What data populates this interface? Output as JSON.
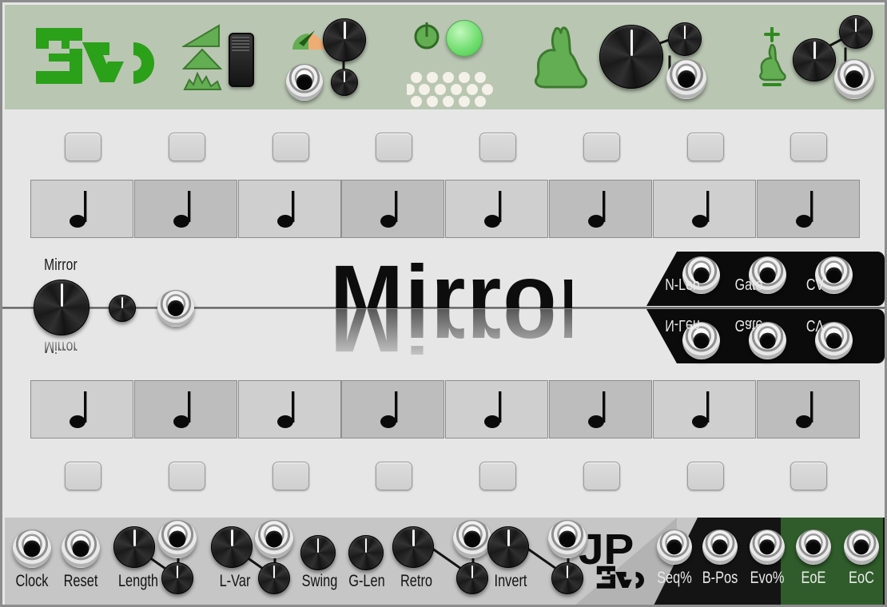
{
  "module": {
    "name": "Mirror",
    "brand": "Evo",
    "maker": "JP",
    "wordmark_top": "Mirror",
    "wordmark_bottom": "Mirror"
  },
  "header": {
    "brand_logo": "evo-logo",
    "controls": [
      {
        "name": "shape-selector",
        "icons": [
          "ramp-shape-icon",
          "triangle-shape-icon",
          "random-shape-icon"
        ],
        "widget": "shape-slider"
      },
      {
        "name": "rate",
        "icon": "gauge-icon",
        "knob": "rate-knob",
        "attenuator": "rate-attenuator-knob",
        "jack": "rate-cv-jack"
      },
      {
        "name": "run",
        "icon": "power-icon",
        "led": "run-led",
        "matrix": "led-matrix"
      },
      {
        "name": "evo-rate",
        "icon": "rabbit-icon",
        "knob": "evo-rate-knob",
        "attenuator": "evo-rate-attenuator-knob",
        "jack": "evo-rate-cv-jack"
      },
      {
        "name": "evo-amount",
        "icon": "small-rabbit-icon",
        "plus": "+",
        "minus": "−",
        "knob": "evo-amount-knob",
        "attenuator": "evo-amount-attenuator-knob",
        "jack": "evo-amount-cv-jack"
      }
    ]
  },
  "sequencer": {
    "step_count": 8,
    "top_buttons": [
      "step-1",
      "step-2",
      "step-3",
      "step-4",
      "step-5",
      "step-6",
      "step-7",
      "step-8"
    ],
    "bottom_buttons": [
      "step-1",
      "step-2",
      "step-3",
      "step-4",
      "step-5",
      "step-6",
      "step-7",
      "step-8"
    ],
    "top_row_cells": [
      {
        "note": "quarter-note",
        "shade": "light"
      },
      {
        "note": "quarter-note",
        "shade": "dark"
      },
      {
        "note": "quarter-note",
        "shade": "light"
      },
      {
        "note": "quarter-note",
        "shade": "dark"
      },
      {
        "note": "quarter-note",
        "shade": "light"
      },
      {
        "note": "quarter-note",
        "shade": "dark"
      },
      {
        "note": "quarter-note",
        "shade": "light"
      },
      {
        "note": "quarter-note",
        "shade": "dark"
      }
    ],
    "bottom_row_cells": [
      {
        "note": "quarter-note",
        "shade": "light"
      },
      {
        "note": "quarter-note",
        "shade": "dark"
      },
      {
        "note": "quarter-note",
        "shade": "light"
      },
      {
        "note": "quarter-note",
        "shade": "dark"
      },
      {
        "note": "quarter-note",
        "shade": "light"
      },
      {
        "note": "quarter-note",
        "shade": "dark"
      },
      {
        "note": "quarter-note",
        "shade": "light"
      },
      {
        "note": "quarter-note",
        "shade": "dark"
      }
    ]
  },
  "mirror_band": {
    "knob_label": "Mirror",
    "knob_label_reflection": "Mirror",
    "attenuator": "mirror-attenuator-knob",
    "jack": "mirror-cv-jack",
    "output_panel_top": [
      "N-Len",
      "Gate",
      "CV"
    ],
    "output_panel_bottom": [
      "N-Len",
      "Gate",
      "CV"
    ]
  },
  "footer": {
    "controls": [
      {
        "label": "Clock",
        "type": "jack"
      },
      {
        "label": "Reset",
        "type": "jack"
      },
      {
        "label": "Length",
        "type": "knob-atten-jack"
      },
      {
        "label": "L-Var",
        "type": "knob-atten-jack"
      },
      {
        "label": "Swing",
        "type": "knob"
      },
      {
        "label": "G-Len",
        "type": "knob"
      },
      {
        "label": "Retro",
        "type": "knob-atten-jack"
      },
      {
        "label": "Invert",
        "type": "knob-atten-jack"
      }
    ],
    "logo_primary": "JP",
    "logo_secondary": "Evo",
    "outputs": [
      {
        "label": "Seq%",
        "highlight": false
      },
      {
        "label": "B-Pos",
        "highlight": false
      },
      {
        "label": "Evo%",
        "highlight": true
      },
      {
        "label": "EoE",
        "highlight": true
      },
      {
        "label": "EoC",
        "highlight": false
      }
    ]
  },
  "colors": {
    "header_bg": "#b9c6b2",
    "panel_bg": "#e6e6e6",
    "brand_green": "#2ba019",
    "accent_green": "#6cbf5c",
    "led_green": "#86e887",
    "output_green": "#2f5c2a",
    "footer_bg": "#c6c6c6",
    "black_panel": "#0b0b0b"
  }
}
